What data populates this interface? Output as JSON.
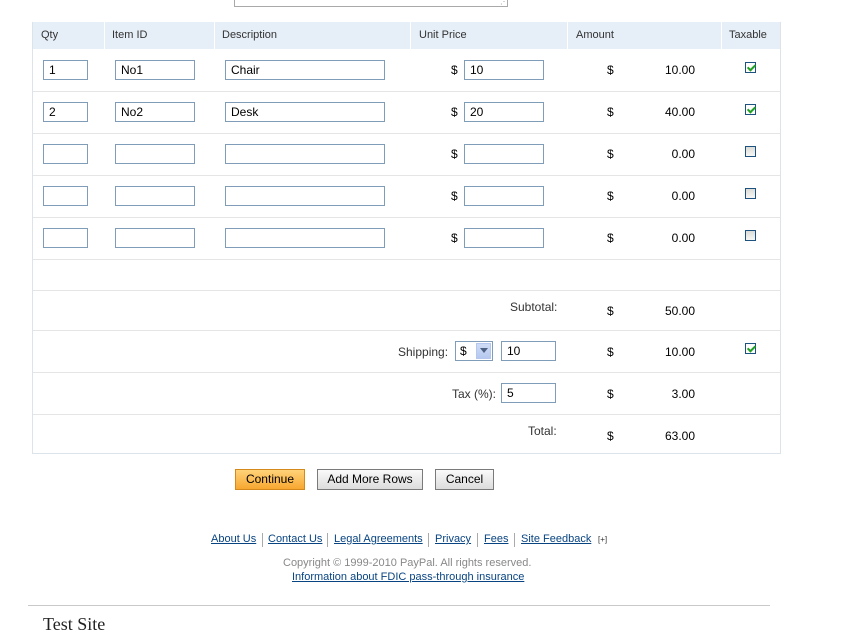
{
  "table": {
    "headers": [
      "Qty",
      "Item ID",
      "Description",
      "Unit Price",
      "Amount",
      "Taxable"
    ],
    "currency_symbol": "$",
    "rows": [
      {
        "qty": "1",
        "item_id": "No1",
        "description": "Chair",
        "unit_price": "10",
        "amount": "10.00",
        "taxable": true
      },
      {
        "qty": "2",
        "item_id": "No2",
        "description": "Desk",
        "unit_price": "20",
        "amount": "40.00",
        "taxable": true
      },
      {
        "qty": "",
        "item_id": "",
        "description": "",
        "unit_price": "",
        "amount": "0.00",
        "taxable": false
      },
      {
        "qty": "",
        "item_id": "",
        "description": "",
        "unit_price": "",
        "amount": "0.00",
        "taxable": false
      },
      {
        "qty": "",
        "item_id": "",
        "description": "",
        "unit_price": "",
        "amount": "0.00",
        "taxable": false
      }
    ]
  },
  "summary": {
    "subtotal_label": "Subtotal:",
    "subtotal_amount": "50.00",
    "shipping_label": "Shipping:",
    "shipping_unit": "$",
    "shipping_value": "10",
    "shipping_amount": "10.00",
    "shipping_taxable": true,
    "tax_label": "Tax (%):",
    "tax_value": "5",
    "tax_amount": "3.00",
    "total_label": "Total:",
    "total_amount": "63.00"
  },
  "buttons": {
    "continue": "Continue",
    "add_more_rows": "Add More Rows",
    "cancel": "Cancel"
  },
  "footer": {
    "links": [
      "About Us",
      "Contact Us",
      "Legal Agreements",
      "Privacy",
      "Fees",
      "Site Feedback"
    ],
    "feedback_icon": "[+]",
    "copyright": "Copyright © 1999-2010 PayPal. All rights reserved.",
    "fdic_link": "Information about FDIC pass-through insurance"
  },
  "site_title": "Test Site",
  "icons": {
    "checkbox_checked": "checkbox-checked-icon",
    "checkbox_unchecked": "checkbox-unchecked-icon",
    "select_arrow": "chevron-down-icon",
    "external": "external-link-icon",
    "resize": "resize-grip-icon"
  }
}
